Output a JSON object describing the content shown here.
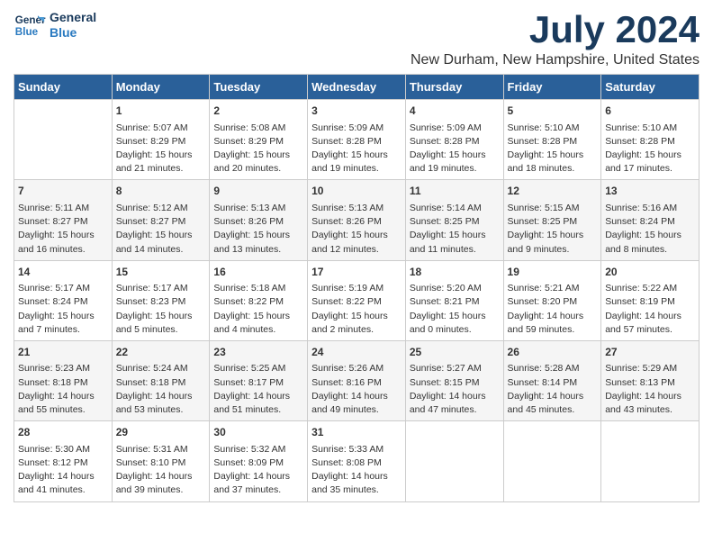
{
  "logo": {
    "line1": "General",
    "line2": "Blue"
  },
  "title": "July 2024",
  "subtitle": "New Durham, New Hampshire, United States",
  "days_of_week": [
    "Sunday",
    "Monday",
    "Tuesday",
    "Wednesday",
    "Thursday",
    "Friday",
    "Saturday"
  ],
  "weeks": [
    [
      {
        "day": "",
        "content": ""
      },
      {
        "day": "1",
        "content": "Sunrise: 5:07 AM\nSunset: 8:29 PM\nDaylight: 15 hours\nand 21 minutes."
      },
      {
        "day": "2",
        "content": "Sunrise: 5:08 AM\nSunset: 8:29 PM\nDaylight: 15 hours\nand 20 minutes."
      },
      {
        "day": "3",
        "content": "Sunrise: 5:09 AM\nSunset: 8:28 PM\nDaylight: 15 hours\nand 19 minutes."
      },
      {
        "day": "4",
        "content": "Sunrise: 5:09 AM\nSunset: 8:28 PM\nDaylight: 15 hours\nand 19 minutes."
      },
      {
        "day": "5",
        "content": "Sunrise: 5:10 AM\nSunset: 8:28 PM\nDaylight: 15 hours\nand 18 minutes."
      },
      {
        "day": "6",
        "content": "Sunrise: 5:10 AM\nSunset: 8:28 PM\nDaylight: 15 hours\nand 17 minutes."
      }
    ],
    [
      {
        "day": "7",
        "content": "Sunrise: 5:11 AM\nSunset: 8:27 PM\nDaylight: 15 hours\nand 16 minutes."
      },
      {
        "day": "8",
        "content": "Sunrise: 5:12 AM\nSunset: 8:27 PM\nDaylight: 15 hours\nand 14 minutes."
      },
      {
        "day": "9",
        "content": "Sunrise: 5:13 AM\nSunset: 8:26 PM\nDaylight: 15 hours\nand 13 minutes."
      },
      {
        "day": "10",
        "content": "Sunrise: 5:13 AM\nSunset: 8:26 PM\nDaylight: 15 hours\nand 12 minutes."
      },
      {
        "day": "11",
        "content": "Sunrise: 5:14 AM\nSunset: 8:25 PM\nDaylight: 15 hours\nand 11 minutes."
      },
      {
        "day": "12",
        "content": "Sunrise: 5:15 AM\nSunset: 8:25 PM\nDaylight: 15 hours\nand 9 minutes."
      },
      {
        "day": "13",
        "content": "Sunrise: 5:16 AM\nSunset: 8:24 PM\nDaylight: 15 hours\nand 8 minutes."
      }
    ],
    [
      {
        "day": "14",
        "content": "Sunrise: 5:17 AM\nSunset: 8:24 PM\nDaylight: 15 hours\nand 7 minutes."
      },
      {
        "day": "15",
        "content": "Sunrise: 5:17 AM\nSunset: 8:23 PM\nDaylight: 15 hours\nand 5 minutes."
      },
      {
        "day": "16",
        "content": "Sunrise: 5:18 AM\nSunset: 8:22 PM\nDaylight: 15 hours\nand 4 minutes."
      },
      {
        "day": "17",
        "content": "Sunrise: 5:19 AM\nSunset: 8:22 PM\nDaylight: 15 hours\nand 2 minutes."
      },
      {
        "day": "18",
        "content": "Sunrise: 5:20 AM\nSunset: 8:21 PM\nDaylight: 15 hours\nand 0 minutes."
      },
      {
        "day": "19",
        "content": "Sunrise: 5:21 AM\nSunset: 8:20 PM\nDaylight: 14 hours\nand 59 minutes."
      },
      {
        "day": "20",
        "content": "Sunrise: 5:22 AM\nSunset: 8:19 PM\nDaylight: 14 hours\nand 57 minutes."
      }
    ],
    [
      {
        "day": "21",
        "content": "Sunrise: 5:23 AM\nSunset: 8:18 PM\nDaylight: 14 hours\nand 55 minutes."
      },
      {
        "day": "22",
        "content": "Sunrise: 5:24 AM\nSunset: 8:18 PM\nDaylight: 14 hours\nand 53 minutes."
      },
      {
        "day": "23",
        "content": "Sunrise: 5:25 AM\nSunset: 8:17 PM\nDaylight: 14 hours\nand 51 minutes."
      },
      {
        "day": "24",
        "content": "Sunrise: 5:26 AM\nSunset: 8:16 PM\nDaylight: 14 hours\nand 49 minutes."
      },
      {
        "day": "25",
        "content": "Sunrise: 5:27 AM\nSunset: 8:15 PM\nDaylight: 14 hours\nand 47 minutes."
      },
      {
        "day": "26",
        "content": "Sunrise: 5:28 AM\nSunset: 8:14 PM\nDaylight: 14 hours\nand 45 minutes."
      },
      {
        "day": "27",
        "content": "Sunrise: 5:29 AM\nSunset: 8:13 PM\nDaylight: 14 hours\nand 43 minutes."
      }
    ],
    [
      {
        "day": "28",
        "content": "Sunrise: 5:30 AM\nSunset: 8:12 PM\nDaylight: 14 hours\nand 41 minutes."
      },
      {
        "day": "29",
        "content": "Sunrise: 5:31 AM\nSunset: 8:10 PM\nDaylight: 14 hours\nand 39 minutes."
      },
      {
        "day": "30",
        "content": "Sunrise: 5:32 AM\nSunset: 8:09 PM\nDaylight: 14 hours\nand 37 minutes."
      },
      {
        "day": "31",
        "content": "Sunrise: 5:33 AM\nSunset: 8:08 PM\nDaylight: 14 hours\nand 35 minutes."
      },
      {
        "day": "",
        "content": ""
      },
      {
        "day": "",
        "content": ""
      },
      {
        "day": "",
        "content": ""
      }
    ]
  ]
}
